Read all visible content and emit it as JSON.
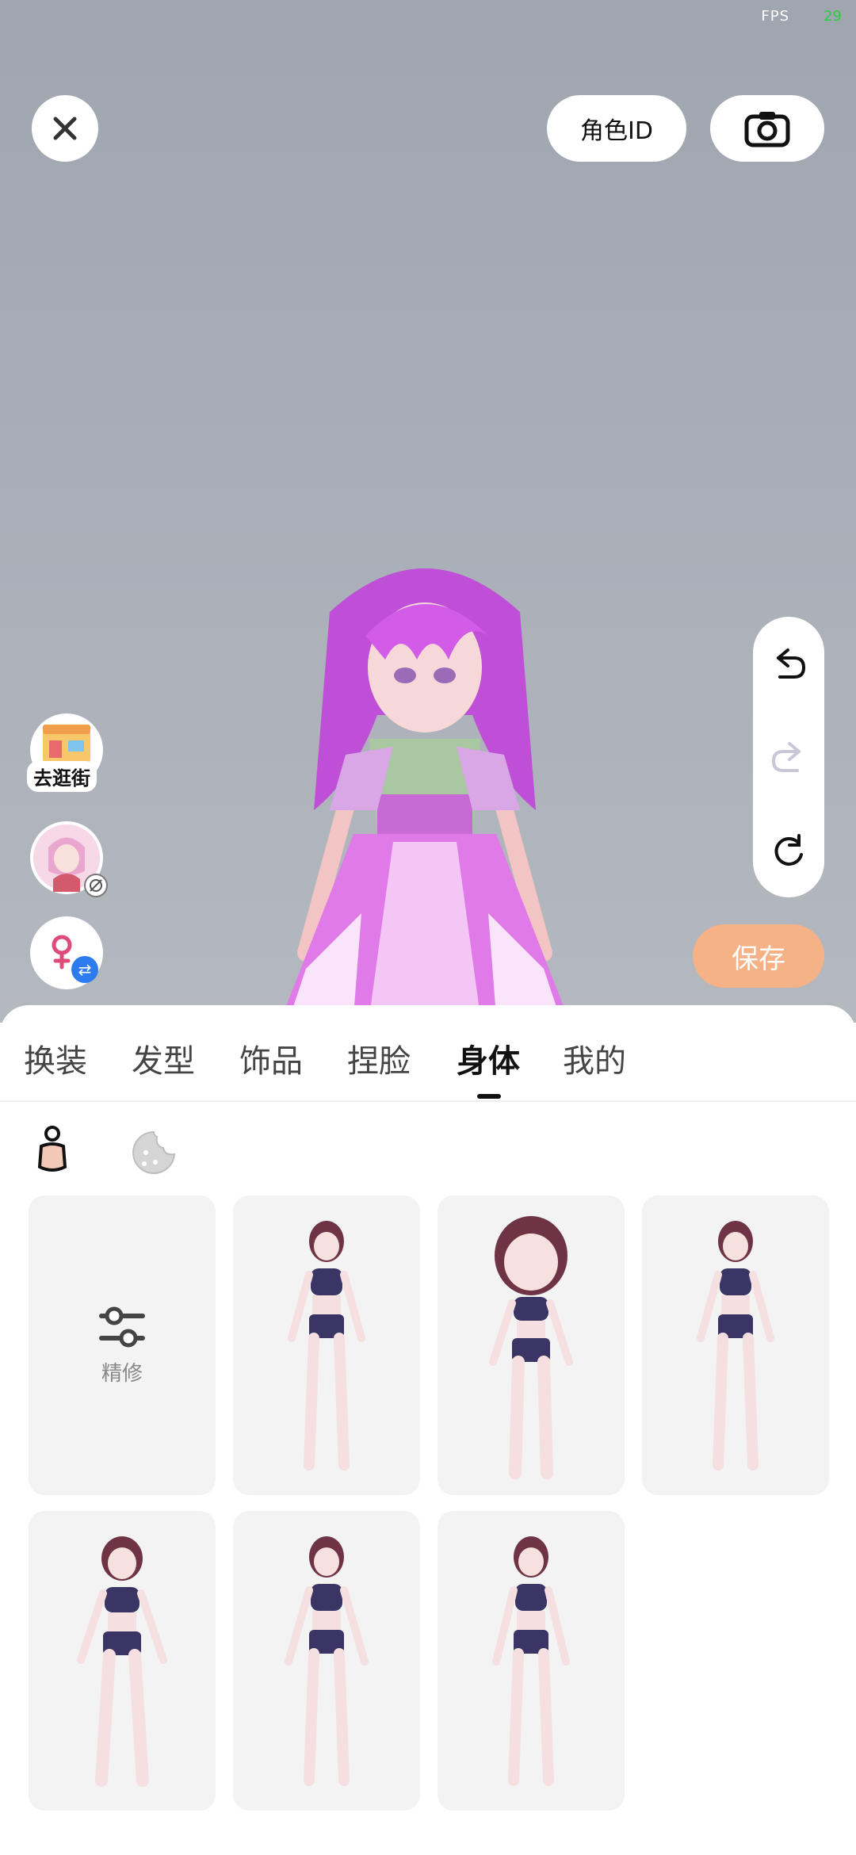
{
  "status": {
    "fps_label": "FPS",
    "fps_value": "29"
  },
  "header": {
    "role_id_label": "角色ID"
  },
  "left_actions": {
    "shop_label": "去逛街"
  },
  "actions": {
    "save_label": "保存"
  },
  "tabs": [
    {
      "label": "换装"
    },
    {
      "label": "发型"
    },
    {
      "label": "饰品"
    },
    {
      "label": "捏脸"
    },
    {
      "label": "身体",
      "active": true
    },
    {
      "label": "我的"
    }
  ],
  "grid": {
    "refine_label": "精修"
  },
  "colors": {
    "accent_save": "#f6b287",
    "fps_green": "#2ecc40",
    "hair": "#c04fd8"
  }
}
